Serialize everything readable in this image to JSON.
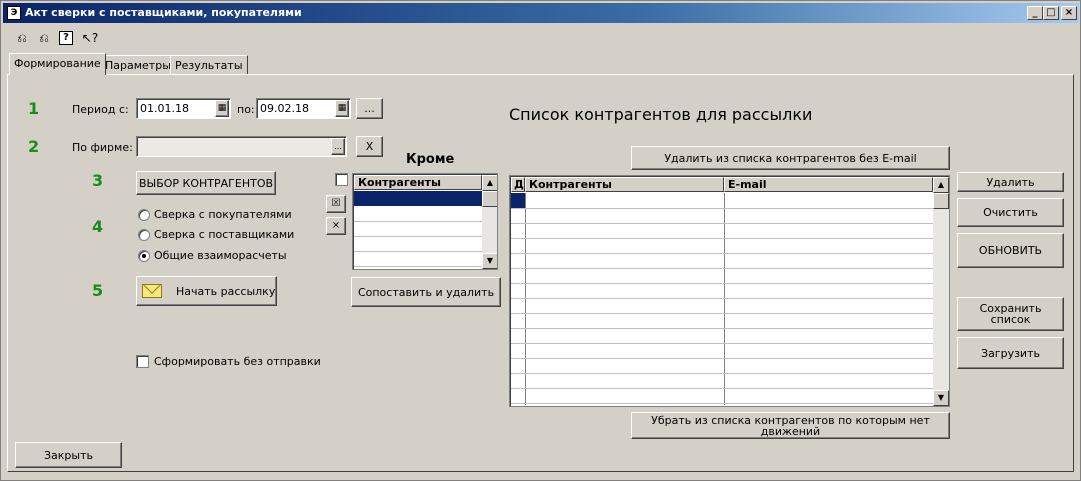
{
  "window": {
    "title": "Акт сверки с поставщиками, покупателями"
  },
  "toolbar": {
    "icons": [
      "tool-back-icon",
      "tool-forward-icon",
      "help-icon",
      "whats-this-icon"
    ]
  },
  "tabs": [
    {
      "label": "Формирование",
      "active": true
    },
    {
      "label": "Параметры",
      "active": false
    },
    {
      "label": "Результаты",
      "active": false
    }
  ],
  "steps": [
    "1",
    "2",
    "3",
    "4",
    "5"
  ],
  "period": {
    "label_from": "Период с:",
    "from": "01.01.18",
    "label_to": "по:",
    "to": "09.02.18",
    "more_button": "..."
  },
  "firm": {
    "label": "По фирме:",
    "value": "",
    "select_button": "...",
    "clear_button": "X"
  },
  "select_contractors_button": "ВЫБОР КОНТРАГЕНТОВ",
  "mode": {
    "options": [
      {
        "label": "Сверка с покупателями",
        "checked": false
      },
      {
        "label": "Сверка с поставщиками",
        "checked": false
      },
      {
        "label": "Общие взаиморасчеты",
        "checked": true
      }
    ]
  },
  "send_button": "Начать рассылку",
  "no_send_checkbox": {
    "label": "Сформировать без отправки",
    "checked": false
  },
  "close_button": "Закрыть",
  "except": {
    "title": "Кроме",
    "column": "Контрагенты",
    "match_delete_button": "Сопоставить и удалить"
  },
  "mail_list": {
    "title": "Список контрагентов для рассылки",
    "remove_no_email_button": "Удалить из списка контрагентов без E-mail",
    "columns": [
      "Д",
      "Контрагенты",
      "E-mail"
    ],
    "remove_no_movement_button": "Убрать из списка контрагентов по которым нет движений"
  },
  "right_buttons": {
    "delete": "Удалить",
    "clear": "Очистить",
    "refresh": "ОБНОВИТЬ",
    "save_list": "Сохранить список",
    "load": "Загрузить"
  }
}
